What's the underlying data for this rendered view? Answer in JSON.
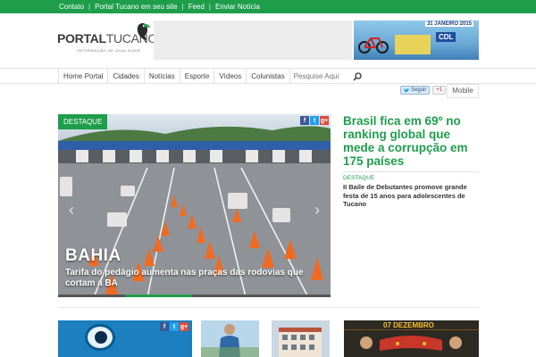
{
  "topbar": {
    "links": [
      "Contato",
      "Portal Tucano em seu site",
      "Feed",
      "Enviar Notícia"
    ],
    "separator": "|"
  },
  "header": {
    "logo_bold": "PORTAL",
    "logo_light": "TUCANO",
    "logo_tagline": "INFORMAÇÃO DE QUALIDADE",
    "banner_date": "31 JANEIRO 2015",
    "banner_brand": "CDL"
  },
  "nav": {
    "items": [
      "Home Portal",
      "Cidades",
      "Notícias",
      "Esporte",
      "Vídeos",
      "Colunistas"
    ],
    "search_placeholder": "Pesquise Aqui"
  },
  "social": {
    "twitter_label": "Seguir",
    "gplus_label": "+1",
    "mobile_label": "Mobile"
  },
  "hero": {
    "tag": "DESTAQUE",
    "city": "BAHIA",
    "caption": "Tarifa do pedágio aumenta nas praças das rodovias que cortam a BA",
    "share_icons": [
      "f",
      "t",
      "g+"
    ]
  },
  "side": {
    "headline": "Brasil fica em 69º no ranking global que mede a corrupção em 175 países",
    "kicker": "DESTAQUE",
    "sub": "II Baile de Debutantes promove grande festa de 15 anos para adolescentes de Tucano"
  },
  "thumbs": {
    "t4_month": "07 DEZEMBRO",
    "t1_share_icons": [
      "f",
      "t",
      "g+"
    ]
  },
  "colors": {
    "brand_green": "#1e9e4b",
    "facebook": "#3b5998",
    "twitter": "#1da1f2",
    "gplus": "#dd4b39"
  }
}
